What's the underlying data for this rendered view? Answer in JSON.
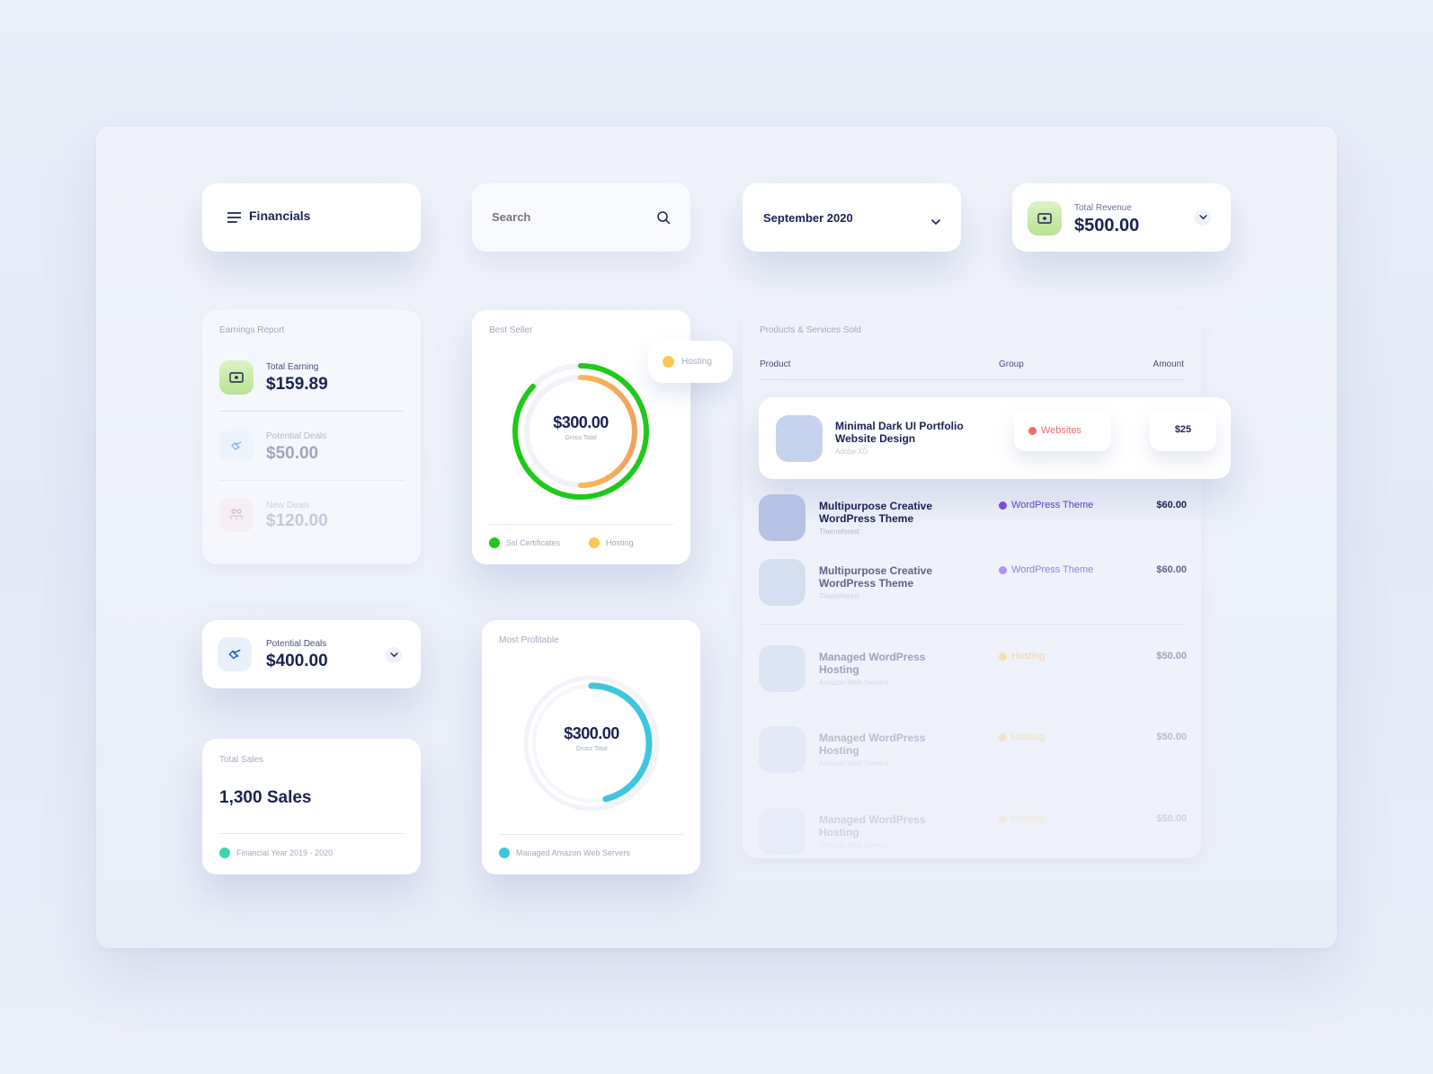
{
  "header": {
    "menu": {
      "label": "Financials"
    },
    "search": {
      "placeholder": "Search"
    },
    "month": {
      "selected": "September 2020"
    },
    "revenue": {
      "label": "Total Revenue",
      "value": "$500.00"
    }
  },
  "earnings": {
    "title": "Earnings Report",
    "items": [
      {
        "label": "Total Earning",
        "value": "$159.89"
      },
      {
        "label": "Potential Deals",
        "value": "$50.00"
      },
      {
        "label": "New Deals",
        "value": "$120.00"
      }
    ]
  },
  "best_seller": {
    "title": "Best Seller",
    "center_value": "$300.00",
    "center_label": "Gross Total",
    "tooltip": "Hosting",
    "legend": [
      {
        "label": "Ssl Certificates",
        "color": "#1fc91a"
      },
      {
        "label": "Hosting",
        "color": "#f9c74f"
      }
    ],
    "outer_fraction": 0.87,
    "inner_fraction": 0.5
  },
  "potential_deals": {
    "label": "Potential Deals",
    "value": "$400.00"
  },
  "total_sales": {
    "title": "Total Sales",
    "value": "1,300 Sales",
    "legend": "Financial Year 2019 - 2020",
    "legend_color": "#3dd6b0"
  },
  "most_profitable": {
    "title": "Most Profitable",
    "center_value": "$300.00",
    "center_label": "Gross Total",
    "legend": "Managed Amazon Web Servers",
    "legend_color": "#3cc6e0",
    "fraction": 0.46
  },
  "products": {
    "title": "Products & Services Sold",
    "columns": {
      "product": "Product",
      "group": "Group",
      "amount": "Amount"
    },
    "highlight": {
      "name_line1": "Minimal Dark UI Portfolio",
      "name_line2": "Website Design",
      "sub": "Adobe XD",
      "group": "Websites",
      "amount": "$25"
    },
    "rows": [
      {
        "name_line1": "Multipurpose Creative",
        "name_line2": "WordPress Theme",
        "sub": "Themeforest",
        "group": "WordPress Theme",
        "amount": "$60.00"
      },
      {
        "name_line1": "Multipurpose Creative",
        "name_line2": "WordPress Theme",
        "sub": "Themeforest",
        "group": "WordPress Theme",
        "amount": "$60.00"
      },
      {
        "name_line1": "Managed WordPress",
        "name_line2": "Hosting",
        "sub": "Amazon Web Servers",
        "group": "Hosting",
        "amount": "$50.00"
      },
      {
        "name_line1": "Managed WordPress",
        "name_line2": "Hosting",
        "sub": "Amazon Web Servers",
        "group": "Hosting",
        "amount": "$50.00"
      },
      {
        "name_line1": "Managed WordPress",
        "name_line2": "Hosting",
        "sub": "Amazon Web Servers",
        "group": "Hosting",
        "amount": "$50.00"
      }
    ]
  },
  "colors": {
    "accent_green": "#1fc91a",
    "accent_orange": "#f5a05a",
    "accent_yellow": "#f9d356",
    "accent_cyan": "#3cc6e0",
    "websites_red": "#f26b6b",
    "wordpress_purple": "#7a4fd6",
    "hosting_yellow": "#f9c74f"
  }
}
